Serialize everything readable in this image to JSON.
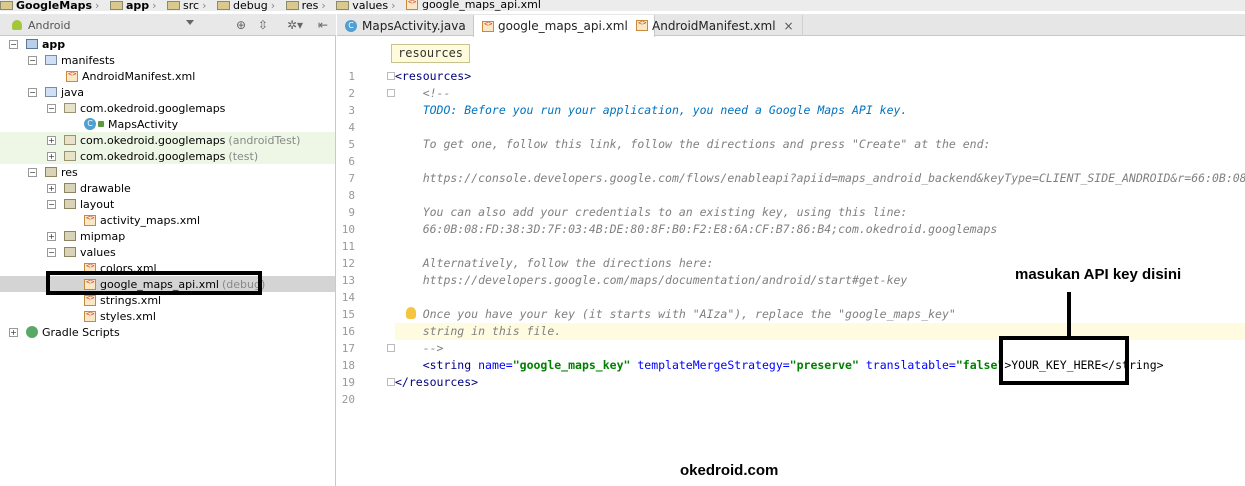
{
  "breadcrumb": {
    "items": [
      "GoogleMaps",
      "app",
      "src",
      "debug",
      "res",
      "values",
      "google_maps_api.xml"
    ]
  },
  "project_panel": {
    "view_select": "Android",
    "tree": {
      "app": "app",
      "manifests": "manifests",
      "manifest_file": "AndroidManifest.xml",
      "java": "java",
      "pkg_main": "com.okedroid.googlemaps",
      "maps_activity": "MapsActivity",
      "pkg_android_test": "com.okedroid.googlemaps",
      "android_test_suffix": "(androidTest)",
      "pkg_test": "com.okedroid.googlemaps",
      "test_suffix": "(test)",
      "res": "res",
      "drawable": "drawable",
      "layout": "layout",
      "activity_maps": "activity_maps.xml",
      "mipmap": "mipmap",
      "values": "values",
      "colors": "colors.xml",
      "google_maps_api": "google_maps_api.xml",
      "debug_suffix": "(debug)",
      "strings": "strings.xml",
      "styles": "styles.xml",
      "gradle_scripts": "Gradle Scripts"
    }
  },
  "editor_tabs": [
    {
      "label": "MapsActivity.java",
      "active": false
    },
    {
      "label": "google_maps_api.xml",
      "active": true
    },
    {
      "label": "AndroidManifest.xml",
      "active": false
    }
  ],
  "editor": {
    "context_label": "resources",
    "line_numbers": [
      "1",
      "2",
      "3",
      "4",
      "5",
      "6",
      "7",
      "8",
      "9",
      "10",
      "11",
      "12",
      "13",
      "14",
      "15",
      "16",
      "17",
      "18",
      "19",
      "20"
    ],
    "lines": {
      "l1": "<resources>",
      "l2": "    <!--",
      "l3": "    TODO: Before you run your application, you need a Google Maps API key.",
      "l5": "    To get one, follow this link, follow the directions and press \"Create\" at the end:",
      "l7": "    https://console.developers.google.com/flows/enableapi?apiid=maps_android_backend&keyType=CLIENT_SIDE_ANDROID&r=66:0B:08:FD:",
      "l9": "    You can also add your credentials to an existing key, using this line:",
      "l10": "    66:0B:08:FD:38:3D:7F:03:4B:DE:80:8F:B0:F2:E8:6A:CF:B7:86:B4;com.okedroid.googlemaps",
      "l12": "    Alternatively, follow the directions here:",
      "l13": "    https://developers.google.com/maps/documentation/android/start#get-key",
      "l15": "    Once you have your key (it starts with \"AIza\"), replace the \"google_maps_key\"",
      "l16": "    string in this file.",
      "l17": "    -->",
      "l18_open": "    <string ",
      "l18_attr1": "name=",
      "l18_val1": "\"google_maps_key\"",
      "l18_attr2": " templateMergeStrategy=",
      "l18_val2": "\"preserve\"",
      "l18_attr3": " translatable=",
      "l18_val3": "\"false\"",
      "l18_text": ">YOUR_KEY_HERE</string>",
      "l19": "</resources>"
    }
  },
  "annotations": {
    "callout": "masukan API key disini",
    "watermark": "okedroid.com"
  }
}
